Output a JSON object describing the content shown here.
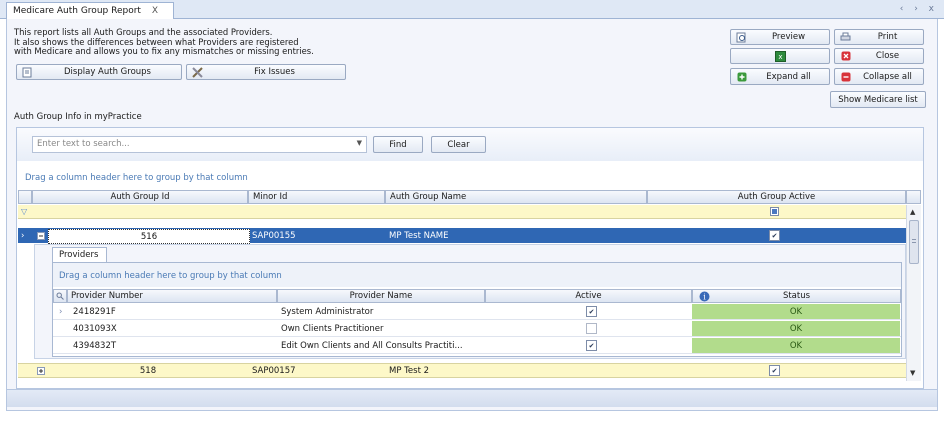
{
  "window": {
    "tab_label": "Medicare Auth Group Report",
    "tab_close": "X",
    "nav_controls": "‹ › x"
  },
  "description": {
    "line1": "This report lists all Auth Groups and the associated Providers.",
    "line2": "It also shows the differences between what Providers are registered",
    "line3": "with Medicare and allows you to fix any mismatches or missing entries."
  },
  "toolbar": {
    "display_auth_groups": "Display Auth Groups",
    "fix_issues": "Fix Issues",
    "preview": "Preview",
    "print": "Print",
    "close": "Close",
    "expand_all": "Expand all",
    "collapse_all": "Collapse all",
    "show_medicare_list": "Show Medicare list"
  },
  "section_label": "Auth Group Info in myPractice",
  "search": {
    "placeholder": "Enter text to search...",
    "find": "Find",
    "clear": "Clear"
  },
  "group_hint": "Drag a column header here to group by that column",
  "columns": [
    "Auth Group Id",
    "Minor Id",
    "Auth Group Name",
    "Auth Group Active"
  ],
  "rows": [
    {
      "id": "516",
      "minor": "SAP00155",
      "name": "MP Test NAME",
      "active": true,
      "expanded": true
    },
    {
      "id": "518",
      "minor": "SAP00157",
      "name": "MP Test 2",
      "active": true,
      "expanded": false
    }
  ],
  "detail": {
    "tab": "Providers",
    "group_hint": "Drag a column header here to group by that column",
    "columns": [
      "Provider Number",
      "Provider Name",
      "Active",
      "Status"
    ],
    "rows": [
      {
        "number": "2418291F",
        "name": "System Administrator",
        "active": true,
        "status": "OK"
      },
      {
        "number": "4031093X",
        "name": "Own Clients Practitioner",
        "active": false,
        "status": "OK"
      },
      {
        "number": "4394832T",
        "name": "Edit Own Clients and All Consults Practiti...",
        "active": true,
        "status": "OK"
      }
    ]
  },
  "colors": {
    "selected_row": "#2f67b4",
    "filter_row": "#fdf8c8",
    "status_ok": "#b2dc8c",
    "panel": "#f3f5fb"
  }
}
